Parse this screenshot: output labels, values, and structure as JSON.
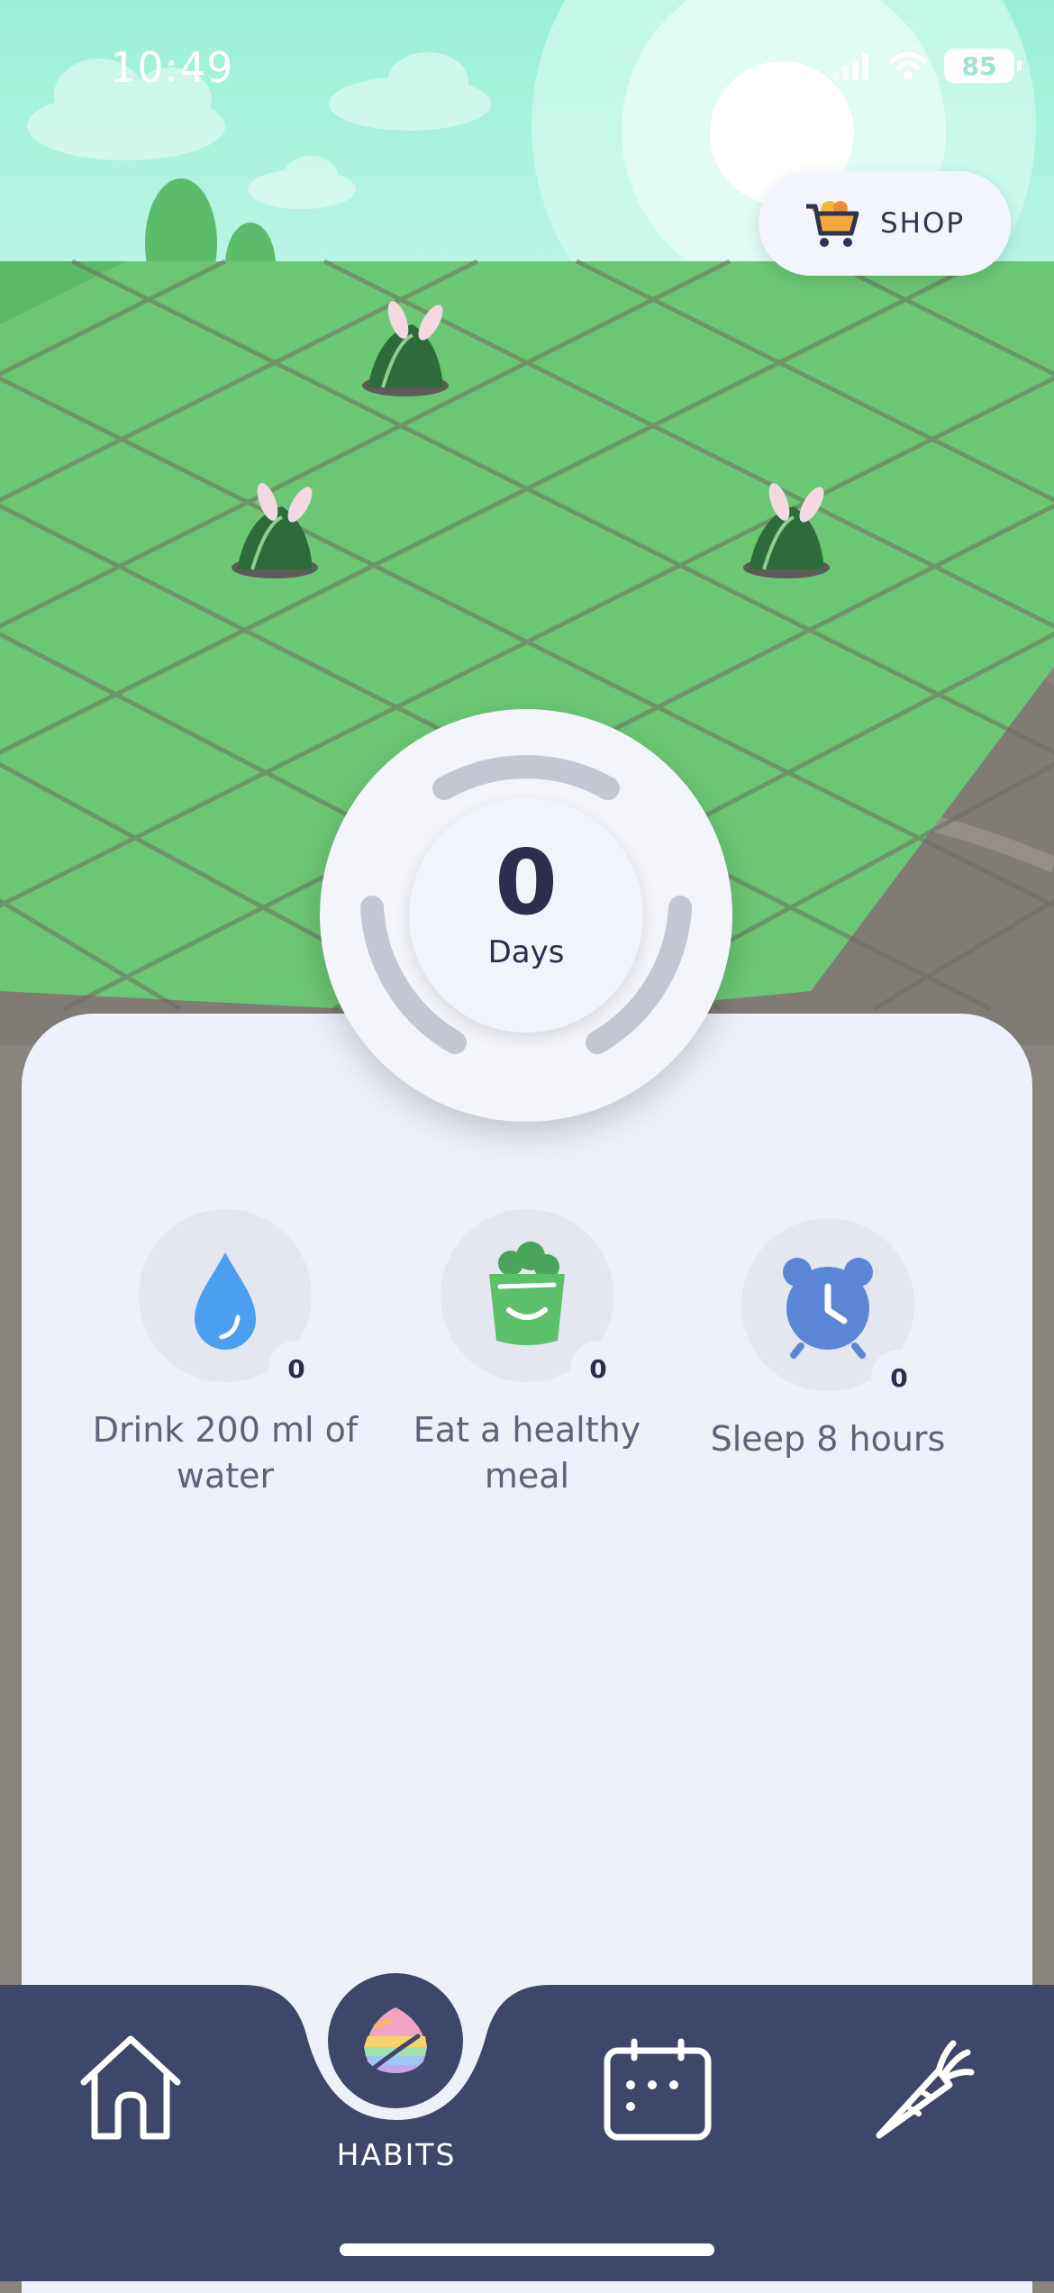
{
  "status_bar": {
    "time": "10:49",
    "battery": "85"
  },
  "shop": {
    "label": "SHOP",
    "icon": "shopping-cart-icon"
  },
  "streak": {
    "count": "0",
    "unit": "Days"
  },
  "habits": [
    {
      "label": "Drink 200 ml of water",
      "count": "0",
      "icon": "water-drop-icon",
      "color": "#4a9ff0"
    },
    {
      "label": "Eat a healthy meal",
      "count": "0",
      "icon": "salad-bowl-icon",
      "color": "#5cbf6a"
    },
    {
      "label": "Sleep 8 hours",
      "count": "0",
      "icon": "alarm-clock-icon",
      "color": "#5b86d6"
    }
  ],
  "nav": {
    "items": [
      {
        "icon": "home-icon"
      },
      {
        "icon": "habits-leaf-icon",
        "label": "HABITS",
        "active": true
      },
      {
        "icon": "calendar-icon"
      },
      {
        "icon": "carrot-icon"
      }
    ]
  },
  "colors": {
    "nav_bg": "#3e4669",
    "panel_bg": "#eef1fa",
    "sky": "#a8f0dc",
    "grass": "#6cc774"
  }
}
